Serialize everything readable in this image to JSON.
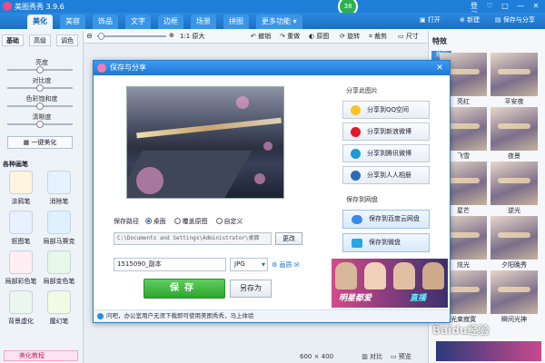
{
  "app": {
    "name": "美图秀秀 3.9.6",
    "badge": "38"
  },
  "window_controls": [
    "登录",
    "♡",
    "□",
    "—",
    "✕"
  ],
  "menu": {
    "tabs": [
      "美化",
      "美容",
      "饰品",
      "文字",
      "边框",
      "场景",
      "拼图",
      "更多功能 ▾"
    ],
    "active": "美化",
    "open": "打开",
    "new": "新建",
    "save_share": "保存与分享"
  },
  "toolbar": {
    "zoom_icon": "zoom-out-icon",
    "ratio": "1:1 原大",
    "undo": "撤销",
    "redo": "重做",
    "original": "原图",
    "rotate": "旋转",
    "crop": "裁剪",
    "size": "尺寸"
  },
  "left": {
    "tabs": [
      "基础",
      "高级",
      "调色"
    ],
    "sliders": [
      "亮度",
      "对比度",
      "色彩饱和度",
      "清晰度"
    ],
    "beauty_button": "一键美化",
    "section": "各种画笔",
    "tools": [
      "涂鸦笔",
      "消除笔",
      "抠图笔",
      "局部马赛克",
      "局部彩色笔",
      "局部变色笔",
      "背景虚化",
      "魔幻笔"
    ],
    "tutorial": "美化教程"
  },
  "right": {
    "title": "特效",
    "subtab": "热门",
    "effects": [
      "亮红",
      "平安夜",
      "飞雪",
      "夜景",
      "星芒",
      "逆光",
      "炫光",
      "夕阳晚秀",
      "光束寂寞",
      "瞬间光神"
    ]
  },
  "status": {
    "size": "600 × 400",
    "compare": "对比",
    "preview": "预览"
  },
  "watermark": "Baidu经验",
  "dialog": {
    "title": "保存与分享",
    "close": "✕",
    "path_label": "保存路径",
    "path_options": [
      "桌面",
      "覆盖原图",
      "自定义"
    ],
    "path_value": "C:\\Documents and Settings\\Administrator\\桌面",
    "change": "更改",
    "filename": "1515090_副本",
    "format": "JPG",
    "advanced": "画质",
    "save": "保存",
    "save_as": "另存为",
    "tip": "问吧，办公室用户无须下载即可使用美图秀秀，马上体验",
    "share_head": "分享此图片",
    "share_buttons": [
      "分享到QQ空间",
      "分享到新浪微博",
      "分享到腾讯微博",
      "分享到人人相册"
    ],
    "cloud_head": "保存到网盘",
    "cloud_buttons": [
      "保存到百度云网盘",
      "保存到微盘"
    ],
    "banner_text": "明星都爱",
    "banner_live": "直播"
  },
  "colors": {
    "accent": "#1f7fd8",
    "save": "#2ea52e",
    "brand": "#f04a8a"
  }
}
